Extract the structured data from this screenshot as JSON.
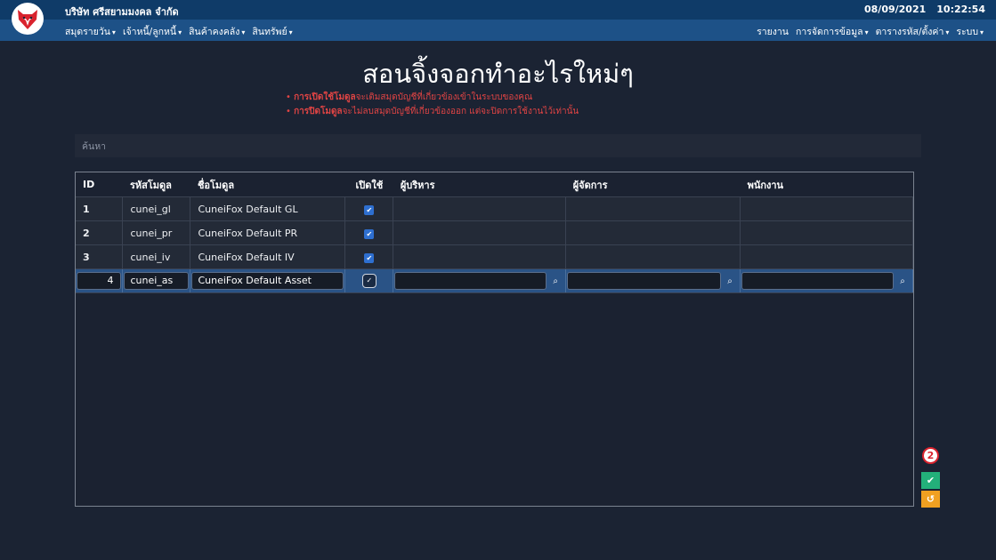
{
  "header": {
    "company": "บริษัท ศรีสยามมงคล จำกัด",
    "date": "08/09/2021",
    "time": "10:22:54",
    "menu_left": [
      {
        "label": "สมุดรายวัน"
      },
      {
        "label": "เจ้าหนี้/ลูกหนี้"
      },
      {
        "label": "สินค้าคงคลัง"
      },
      {
        "label": "สินทรัพย์"
      }
    ],
    "menu_right": [
      {
        "label": "รายงาน",
        "dropdown": false
      },
      {
        "label": "การจัดการข้อมูล",
        "dropdown": true
      },
      {
        "label": "ตารางรหัส/ตั้งค่า",
        "dropdown": true
      },
      {
        "label": "ระบบ",
        "dropdown": true
      }
    ]
  },
  "page": {
    "title": "สอนจิ้งจอกทำอะไรใหม่ๆ",
    "note1_bold": "การเปิดใช้โมดูล",
    "note1_rest": "จะเติมสมุดบัญชีที่เกี่ยวข้องเข้าในระบบของคุณ",
    "note2_bold": "การปิดโมดูล",
    "note2_rest": "จะไม่ลบสมุดบัญชีที่เกี่ยวข้องออก แต่จะปิดการใช้งานไว้เท่านั้น",
    "bullet": "•"
  },
  "search": {
    "placeholder": "ค้นหา"
  },
  "table": {
    "headers": {
      "id": "ID",
      "code": "รหัสโมดูล",
      "name": "ชื่อโมดูล",
      "enabled": "เปิดใช้",
      "admin": "ผู้บริหาร",
      "manager": "ผู้จัดการ",
      "staff": "พนักงาน"
    },
    "rows": [
      {
        "id": "1",
        "code": "cunei_gl",
        "name": "CuneiFox Default GL",
        "enabled": true
      },
      {
        "id": "2",
        "code": "cunei_pr",
        "name": "CuneiFox Default PR",
        "enabled": true
      },
      {
        "id": "3",
        "code": "cunei_iv",
        "name": "CuneiFox Default IV",
        "enabled": true
      }
    ],
    "edit_row": {
      "id": "4",
      "code": "cunei_as",
      "name": "CuneiFox Default Asset",
      "enabled": true,
      "admin": "",
      "manager": "",
      "staff": ""
    }
  },
  "actions": {
    "badge": "2",
    "confirm_icon": "check-icon",
    "undo_icon": "undo-icon"
  },
  "icons": {
    "check": "✔",
    "search": "🔍",
    "caret": "▾",
    "undo": "↺",
    "check_small": "✓"
  },
  "colors": {
    "accent": "#1d5187",
    "header_dark": "#0f3b68",
    "warning_text": "#e04444",
    "ok": "#23b07a",
    "undo": "#f0a021",
    "badge_red": "#d9232e"
  }
}
